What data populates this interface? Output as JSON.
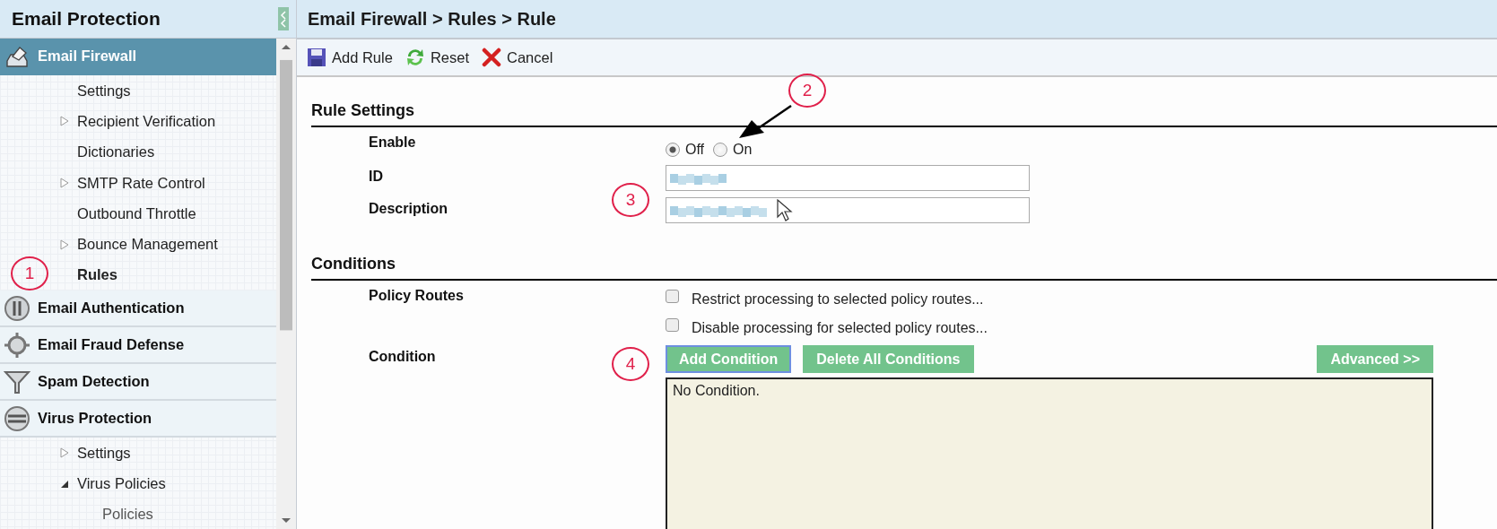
{
  "sidebar": {
    "title": "Email Protection",
    "items": [
      {
        "label": "Email Firewall",
        "kind": "firewall",
        "selected": true,
        "children": [
          {
            "label": "Settings",
            "selected": false
          },
          {
            "label": "Recipient Verification",
            "selected": false,
            "expanded": false
          },
          {
            "label": "Dictionaries",
            "selected": false
          },
          {
            "label": "SMTP Rate Control",
            "selected": false,
            "expanded": false
          },
          {
            "label": "Outbound Throttle",
            "selected": false
          },
          {
            "label": "Bounce Management",
            "selected": false,
            "expanded": false
          },
          {
            "label": "Rules",
            "selected": true
          }
        ]
      },
      {
        "label": "Email Authentication",
        "kind": "authentication",
        "selected": false
      },
      {
        "label": "Email Fraud Defense",
        "kind": "fraud",
        "selected": false
      },
      {
        "label": "Spam Detection",
        "kind": "spam",
        "selected": false
      },
      {
        "label": "Virus Protection",
        "kind": "virus",
        "selected": false,
        "children": [
          {
            "label": "Settings",
            "selected": false,
            "expanded": false
          },
          {
            "label": "Virus Policies",
            "selected": false,
            "expanded": true,
            "children": [
              {
                "label": "Policies",
                "selected": false
              }
            ]
          }
        ]
      }
    ]
  },
  "page": {
    "breadcrumb": "Email Firewall > Rules > Rule",
    "toolbar": [
      {
        "label": "Add Rule",
        "kind": "save"
      },
      {
        "label": "Reset",
        "kind": "reset"
      },
      {
        "label": "Cancel",
        "kind": "cancel"
      }
    ],
    "rule_settings": {
      "heading": "Rule Settings",
      "enable": {
        "label": "Enable",
        "options": [
          {
            "label": "Off",
            "selected": true
          },
          {
            "label": "On",
            "selected": false
          }
        ]
      },
      "id": {
        "label": "ID",
        "redacted": true
      },
      "description": {
        "label": "Description",
        "redacted": true
      }
    },
    "conditions": {
      "heading": "Conditions",
      "policy_routes": {
        "label": "Policy Routes",
        "options": [
          {
            "label": "Restrict processing to selected policy routes...",
            "checked": false
          },
          {
            "label": "Disable processing for selected policy routes...",
            "checked": false
          }
        ]
      },
      "condition": {
        "label": "Condition",
        "buttons": [
          {
            "label": "Add Condition",
            "focused": true
          },
          {
            "label": "Delete All Conditions",
            "focused": false
          }
        ],
        "advanced": "Advanced >>",
        "empty_text": "No Condition."
      }
    }
  },
  "annotations": [
    {
      "label": "1"
    },
    {
      "label": "2"
    },
    {
      "label": "3"
    },
    {
      "label": "4"
    }
  ]
}
